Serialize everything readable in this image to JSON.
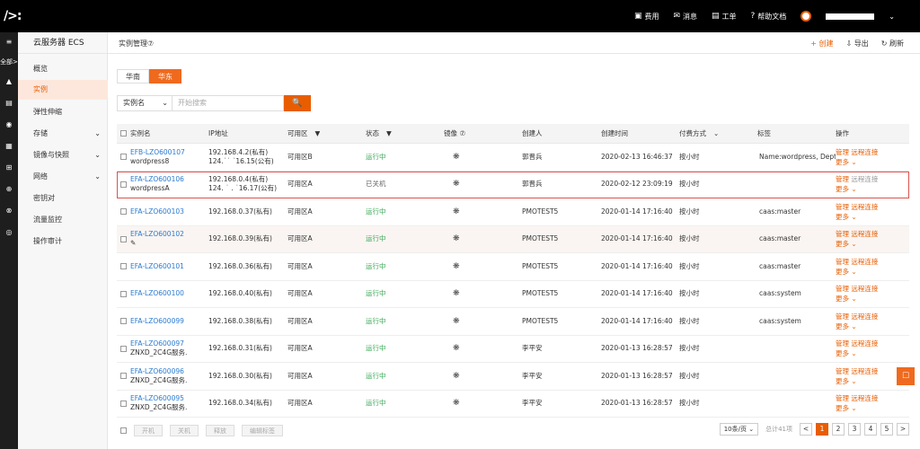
{
  "topbar": {
    "logo": "/>:",
    "nav": [
      {
        "icon": "billing-icon",
        "glyph": "▣",
        "label": "费用"
      },
      {
        "icon": "message-icon",
        "glyph": "✉",
        "label": "消息"
      },
      {
        "icon": "ticket-icon",
        "glyph": "▤",
        "label": "工单"
      },
      {
        "icon": "help-icon",
        "glyph": "?",
        "label": "帮助文档"
      }
    ],
    "user_chevron": "⌄"
  },
  "rail": {
    "menu_glyph": "≡",
    "all_label": "全部>",
    "icons": [
      "▲",
      "▤",
      "◉",
      "▦",
      "⊞",
      "⊕",
      "⊗",
      "◎"
    ]
  },
  "sidebar": {
    "title": "云服务器 ECS",
    "items": [
      {
        "label": "概览",
        "chevron": ""
      },
      {
        "label": "实例",
        "chevron": "",
        "active": true
      },
      {
        "label": "弹性伸缩",
        "chevron": ""
      },
      {
        "label": "存储",
        "chevron": "⌄"
      },
      {
        "label": "镜像与快照",
        "chevron": "⌄"
      },
      {
        "label": "网络",
        "chevron": "⌄"
      },
      {
        "label": "密钥对",
        "chevron": ""
      },
      {
        "label": "流量监控",
        "chevron": ""
      },
      {
        "label": "操作审计",
        "chevron": ""
      }
    ]
  },
  "main": {
    "title": "实例管理⑦",
    "actions": {
      "create": "+ 创建",
      "export": "⇩ 导出",
      "refresh": "↻ 刷新"
    },
    "regions": [
      "华南",
      "华东"
    ],
    "search": {
      "field": "实例名",
      "field_arrow": "⌄",
      "placeholder": "开始搜索",
      "button": "🔍"
    }
  },
  "table": {
    "headers": {
      "name": "实例名",
      "ip": "IP地址",
      "zone": "可用区",
      "zone_filter": "▼",
      "status": "状态",
      "status_filter": "▼",
      "image": "镜像 ⑦",
      "creator": "创建人",
      "created": "创建时间",
      "billing": "付费方式",
      "billing_chevron": "⌄",
      "tags": "标签",
      "ops": "操作"
    },
    "ops_labels": {
      "manage": "管理",
      "remote": "远程连接",
      "more": "更多 ⌄"
    },
    "rows": [
      {
        "name": "EFB-LZO600107",
        "sub": "wordpress8",
        "ip1": "192.168.4.2(私有)",
        "ip2": "124.˙˙ ˙16.15(公有)",
        "zone": "可用区B",
        "status": "运行中",
        "status_kind": "ok",
        "image": "❋",
        "creator": "郭晋兵",
        "created": "2020-02-13 16:46:37",
        "billing": "按小时",
        "tags": "Name:wordpress, Dept...",
        "hl": false,
        "sel": false
      },
      {
        "name": "EFA-LZO600106",
        "sub": "wordpressA",
        "ip1": "192.168.0.4(私有)",
        "ip2": "124. ˙ . ˙16.17(公有)",
        "zone": "可用区A",
        "status": "已关机",
        "status_kind": "off",
        "image": "❋",
        "creator": "郭晋兵",
        "created": "2020-02-12 23:09:19",
        "billing": "按小时",
        "tags": "",
        "hl": false,
        "sel": true
      },
      {
        "name": "EFA-LZO600103",
        "sub": "",
        "ip1": "192.168.0.37(私有)",
        "ip2": "",
        "zone": "可用区A",
        "status": "运行中",
        "status_kind": "ok",
        "image": "❋",
        "creator": "PMOTEST5",
        "created": "2020-01-14 17:16:40",
        "billing": "按小时",
        "tags": "caas:master",
        "hl": false,
        "sel": false
      },
      {
        "name": "EFA-LZO600102",
        "sub": "✎",
        "ip1": "192.168.0.39(私有)",
        "ip2": "",
        "zone": "可用区A",
        "status": "运行中",
        "status_kind": "ok",
        "image": "❋",
        "creator": "PMOTEST5",
        "created": "2020-01-14 17:16:40",
        "billing": "按小时",
        "tags": "caas:master",
        "hl": true,
        "sel": false
      },
      {
        "name": "EFA-LZO600101",
        "sub": "",
        "ip1": "192.168.0.36(私有)",
        "ip2": "",
        "zone": "可用区A",
        "status": "运行中",
        "status_kind": "ok",
        "image": "❋",
        "creator": "PMOTEST5",
        "created": "2020-01-14 17:16:40",
        "billing": "按小时",
        "tags": "caas:master",
        "hl": false,
        "sel": false
      },
      {
        "name": "EFA-LZO600100",
        "sub": "",
        "ip1": "192.168.0.40(私有)",
        "ip2": "",
        "zone": "可用区A",
        "status": "运行中",
        "status_kind": "ok",
        "image": "❋",
        "creator": "PMOTEST5",
        "created": "2020-01-14 17:16:40",
        "billing": "按小时",
        "tags": "caas:system",
        "hl": false,
        "sel": false
      },
      {
        "name": "EFA-LZO600099",
        "sub": "",
        "ip1": "192.168.0.38(私有)",
        "ip2": "",
        "zone": "可用区A",
        "status": "运行中",
        "status_kind": "ok",
        "image": "❋",
        "creator": "PMOTEST5",
        "created": "2020-01-14 17:16:40",
        "billing": "按小时",
        "tags": "caas:system",
        "hl": false,
        "sel": false
      },
      {
        "name": "EFA-LZO600097",
        "sub": "ZNXD_2C4G服务.",
        "ip1": "192.168.0.31(私有)",
        "ip2": "",
        "zone": "可用区A",
        "status": "运行中",
        "status_kind": "ok",
        "image": "❋",
        "creator": "李平安",
        "created": "2020-01-13 16:28:57",
        "billing": "按小时",
        "tags": "",
        "hl": false,
        "sel": false
      },
      {
        "name": "EFA-LZO600096",
        "sub": "ZNXD_2C4G服务.",
        "ip1": "192.168.0.30(私有)",
        "ip2": "",
        "zone": "可用区A",
        "status": "运行中",
        "status_kind": "ok",
        "image": "❋",
        "creator": "李平安",
        "created": "2020-01-13 16:28:57",
        "billing": "按小时",
        "tags": "",
        "hl": false,
        "sel": false
      },
      {
        "name": "EFA-LZO600095",
        "sub": "ZNXD_2C4G服务.",
        "ip1": "192.168.0.34(私有)",
        "ip2": "",
        "zone": "可用区A",
        "status": "运行中",
        "status_kind": "ok",
        "image": "❋",
        "creator": "李平安",
        "created": "2020-01-13 16:28:57",
        "billing": "按小时",
        "tags": "",
        "hl": false,
        "sel": false
      }
    ]
  },
  "footer": {
    "buttons": [
      "开机",
      "关机",
      "释放",
      "编辑标签"
    ],
    "page_size": "10条/页",
    "page_size_arrow": "⌄",
    "total": "总计41项",
    "prev": "<",
    "next": ">",
    "pages": [
      "1",
      "2",
      "3",
      "4",
      "5"
    ],
    "current_page": "1"
  },
  "float_glyph": "☐",
  "colors": {
    "accent": "#e85d00",
    "link": "#2b7bd1",
    "running": "#3aa856"
  }
}
